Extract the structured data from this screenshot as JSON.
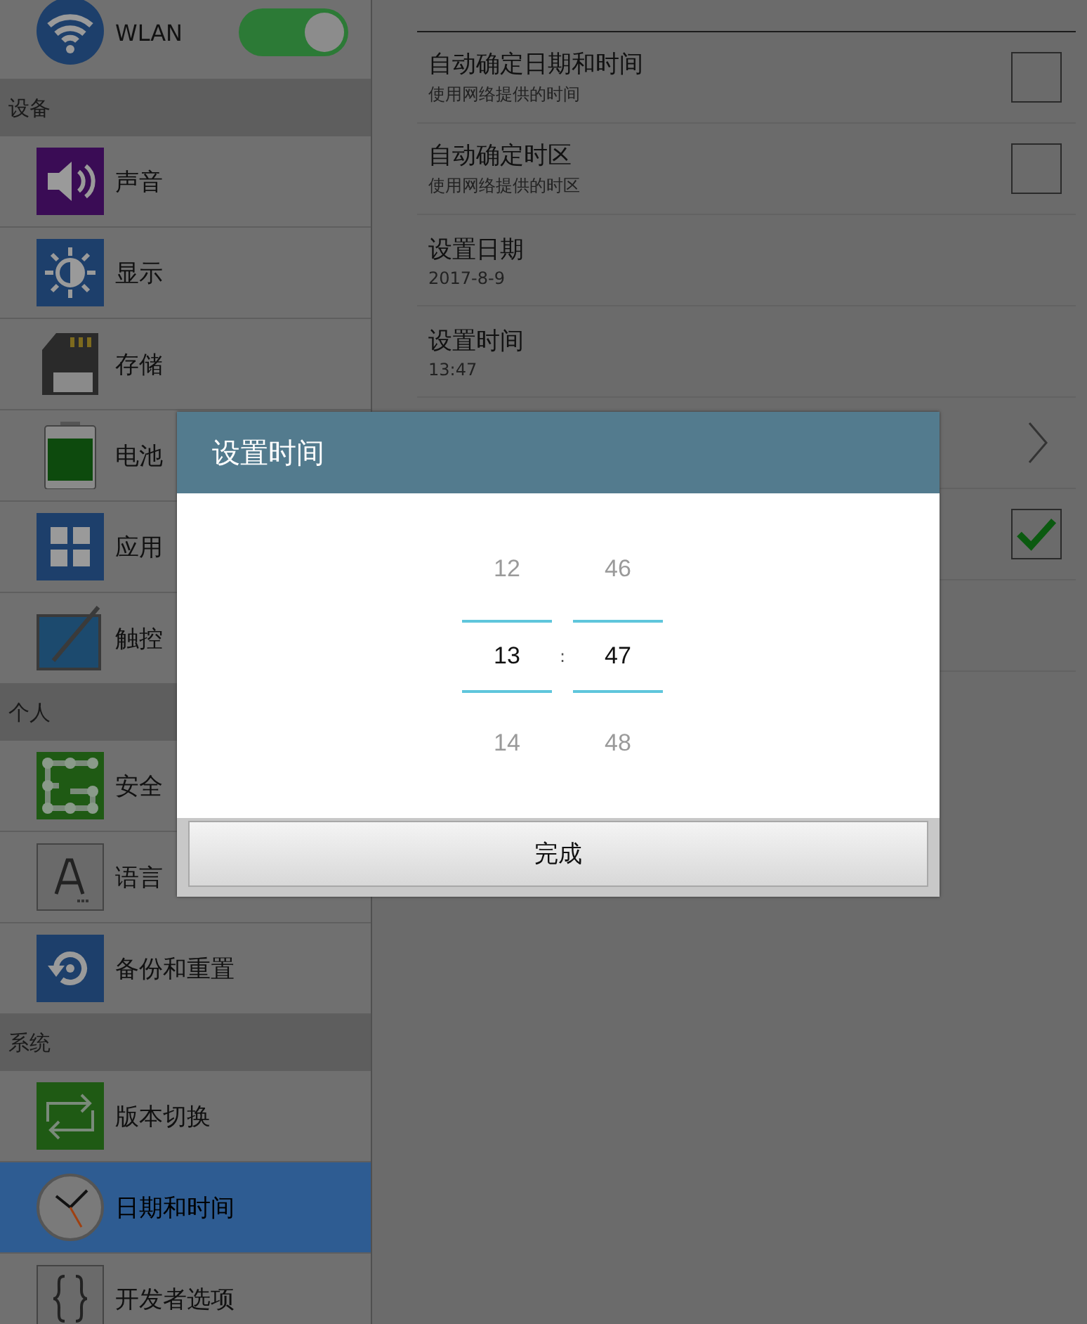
{
  "sidebar": {
    "wlan": {
      "label": "WLAN",
      "on": true
    },
    "sections": [
      {
        "header": "设备",
        "items": [
          {
            "label": "声音",
            "selected": false
          },
          {
            "label": "显示",
            "selected": false
          },
          {
            "label": "存储",
            "selected": false
          },
          {
            "label": "电池",
            "selected": false
          },
          {
            "label": "应用",
            "selected": false
          },
          {
            "label": "触控",
            "selected": false
          }
        ]
      },
      {
        "header": "个人",
        "items": [
          {
            "label": "安全",
            "selected": false
          },
          {
            "label": "语言",
            "selected": false
          },
          {
            "label": "备份和重置",
            "selected": false
          }
        ]
      },
      {
        "header": "系统",
        "items": [
          {
            "label": "版本切换",
            "selected": false
          },
          {
            "label": "日期和时间",
            "selected": true
          },
          {
            "label": "开发者选项",
            "selected": false
          }
        ]
      }
    ]
  },
  "settings": {
    "rows": [
      {
        "kind": "checkbox",
        "title": "自动确定日期和时间",
        "subtitle": "使用网络提供的时间",
        "checked": false
      },
      {
        "kind": "checkbox",
        "title": "自动确定时区",
        "subtitle": "使用网络提供的时区",
        "checked": false
      },
      {
        "kind": "value",
        "title": "设置日期",
        "subtitle": "2017-8-9"
      },
      {
        "kind": "value",
        "title": "设置时间",
        "subtitle": "13:47"
      },
      {
        "kind": "link"
      },
      {
        "kind": "checkbox",
        "checked": true
      },
      {
        "kind": "blank"
      }
    ]
  },
  "dialog": {
    "title": "设置时间",
    "hours": {
      "prev": "12",
      "current": "13",
      "next": "14"
    },
    "separator": ":",
    "minutes": {
      "prev": "46",
      "current": "47",
      "next": "48"
    },
    "done_button": "完成"
  }
}
